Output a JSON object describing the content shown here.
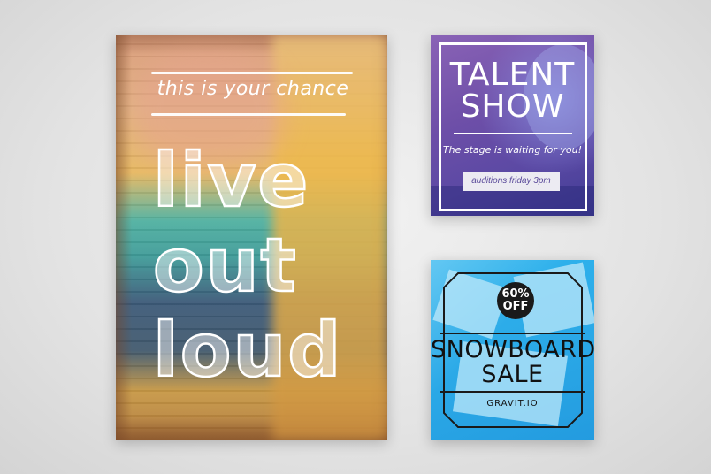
{
  "posters": {
    "live": {
      "tagline": "this is your chance",
      "line1": "live",
      "line2": "out",
      "line3": "loud"
    },
    "talent": {
      "title_line1": "TALENT",
      "title_line2": "SHOW",
      "subtitle": "The stage is waiting for you!",
      "cta": "auditions friday 3pm"
    },
    "snowboard": {
      "badge_percent": "60%",
      "badge_off": "OFF",
      "title_line1": "SNOWBOARD",
      "title_line2": "SALE",
      "website": "GRAVIT.IO"
    }
  },
  "colors": {
    "background": "#e3e3e3",
    "talent_purple": "#6e4fa8",
    "snow_blue": "#2aa7e6",
    "badge_black": "#1a1a1a",
    "text_white": "#ffffff"
  }
}
